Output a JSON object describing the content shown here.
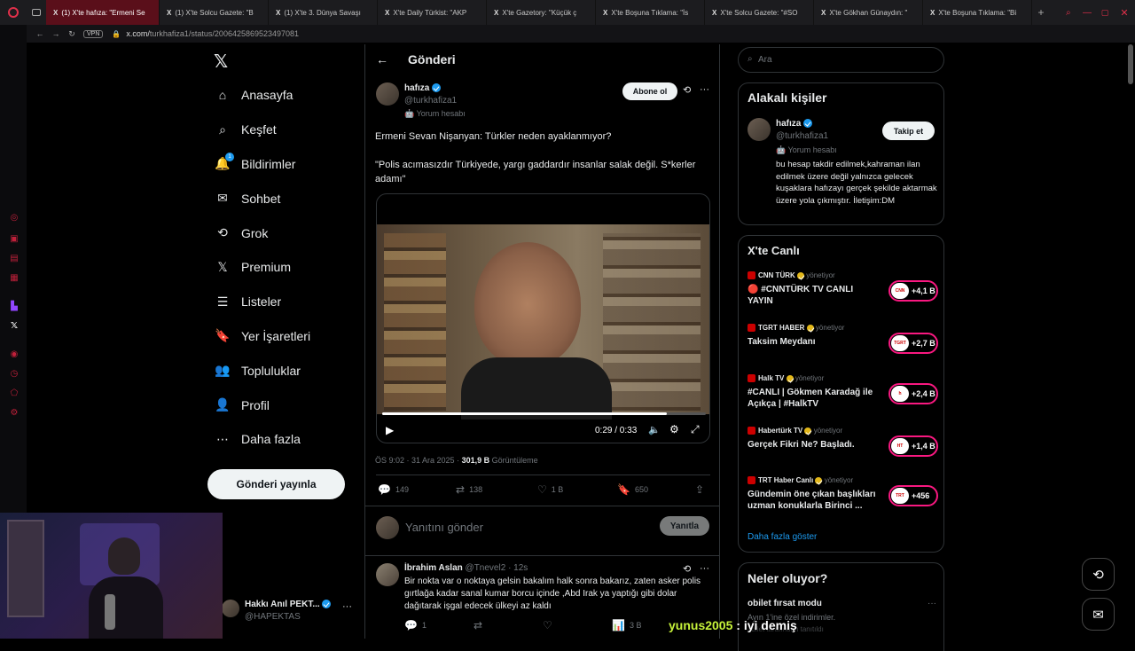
{
  "browser": {
    "tabs": [
      {
        "label": "(1) X'te hafıza: \"Ermeni Se",
        "active": true
      },
      {
        "label": "(1) X'te Solcu Gazete: \"B",
        "active": false
      },
      {
        "label": "(1) X'te 3. Dünya Savaşı",
        "active": false
      },
      {
        "label": "X'te Daily Türkist: \"AKP",
        "active": false
      },
      {
        "label": "X'te Gazetory: \"Küçük ç",
        "active": false
      },
      {
        "label": "X'te Boşuna Tıklama: \"İs",
        "active": false
      },
      {
        "label": "X'te Solcu Gazete: \"#SO",
        "active": false
      },
      {
        "label": "X'te Gökhan Günaydın: \"",
        "active": false
      },
      {
        "label": "X'te Boşuna Tıklama: \"Bi",
        "active": false
      }
    ],
    "vpn_label": "VPN",
    "url_host": "x.com/",
    "url_path": "turkhafiza1/status/2006425869523497081",
    "accent": "#c0203a"
  },
  "nav": {
    "items": [
      {
        "label": "Anasayfa",
        "icon": "home-icon"
      },
      {
        "label": "Keşfet",
        "icon": "search-icon"
      },
      {
        "label": "Bildirimler",
        "icon": "bell-icon",
        "badge": "1"
      },
      {
        "label": "Sohbet",
        "icon": "mail-icon"
      },
      {
        "label": "Grok",
        "icon": "grok-icon"
      },
      {
        "label": "Premium",
        "icon": "x-logo-icon"
      },
      {
        "label": "Listeler",
        "icon": "list-icon"
      },
      {
        "label": "Yer İşaretleri",
        "icon": "bookmark-icon"
      },
      {
        "label": "Topluluklar",
        "icon": "communities-icon"
      },
      {
        "label": "Profil",
        "icon": "user-icon"
      },
      {
        "label": "Daha fazla",
        "icon": "more-icon"
      }
    ],
    "post_button": "Gönderi yayınla",
    "account": {
      "name": "Hakkı Anıl PEKT...",
      "handle": "@HAPEKTAS"
    }
  },
  "main": {
    "header_title": "Gönderi",
    "tweet": {
      "author_name": "hafıza",
      "author_handle": "@turkhafiza1",
      "author_label": "Yorum hesabı",
      "subscribe_label": "Abone ol",
      "text_line1": "Ermeni Sevan Nişanyan: Türkler neden ayaklanmıyor?",
      "text_line2": "\"Polis acımasızdır Türkiyede, yargı gaddardır insanlar salak değil. S*kerler adamı\"",
      "video_time": "0:29 / 0:33",
      "video_progress": 0.88,
      "timestamp": "ÖS 9:02 · 31 Ara 2025 ·",
      "views_count": "301,9 B",
      "views_label": "Görüntüleme",
      "replies": "149",
      "retweets": "138",
      "likes": "1 B",
      "bookmarks": "650"
    },
    "reply_box": {
      "placeholder": "Yanıtını gönder",
      "button": "Yanıtla"
    },
    "reply": {
      "author_name": "İbrahim Aslan",
      "author_handle": "@Tnevel2",
      "time": "· 12s",
      "text": "Bir nokta var o noktaya gelsin bakalım halk sonra bakarız, zaten asker polis gırtlağa kadar sanal kumar borcu içinde ,Abd  Irak ya yaptığı gibi dolar dağıtarak işgal edecek ülkeyi az kaldı",
      "replies": "1",
      "views": "3 B"
    }
  },
  "right": {
    "search_placeholder": "Ara",
    "related": {
      "title": "Alakalı kişiler",
      "name": "hafıza",
      "handle": "@turkhafiza1",
      "label": "Yorum hesabı",
      "follow_button": "Takip et",
      "bio": "bu hesap takdir edilmek,kahraman ilan edilmek üzere değil yalnızca gelecek kuşaklara hafızayı gerçek şekilde aktarmak üzere yola çıkmıştır. İletişim:DM"
    },
    "live": {
      "title": "X'te Canlı",
      "items": [
        {
          "source": "CNN TÜRK",
          "status": "yönetiyor",
          "title": "🔴 #CNNTÜRK TV CANLI YAYIN",
          "count": "+4,1 B",
          "logo": "CNN"
        },
        {
          "source": "TGRT HABER",
          "status": "yönetiyor",
          "title": "Taksim Meydanı",
          "count": "+2,7 B",
          "logo": "TGRT"
        },
        {
          "source": "Halk TV",
          "status": "yönetiyor",
          "title": "#CANLI | Gökmen Karadağ ile Açıkça | #HalkTV",
          "count": "+2,4 B",
          "logo": "h"
        },
        {
          "source": "Habertürk TV",
          "status": "yönetiyor",
          "title": "Gerçek Fikri Ne? Başladı.",
          "count": "+1,4 B",
          "logo": "HT"
        },
        {
          "source": "TRT Haber Canlı",
          "status": "yönetiyor",
          "title": "Gündemin öne çıkan başlıkları uzman konuklarla Birinci ...",
          "count": "+456",
          "logo": "TRT"
        }
      ],
      "show_more": "Daha fazla göster"
    },
    "trending": {
      "title": "Neler oluyor?",
      "item_title": "obilet fırsat modu",
      "item_sub": "Ayın 1'ine özel indirimler.",
      "item_promo": "obilet tarafından tanıtıldı"
    }
  },
  "stream": {
    "chat_user": "yunus2005",
    "chat_sep": " : ",
    "chat_msg": "iyi demiş"
  }
}
